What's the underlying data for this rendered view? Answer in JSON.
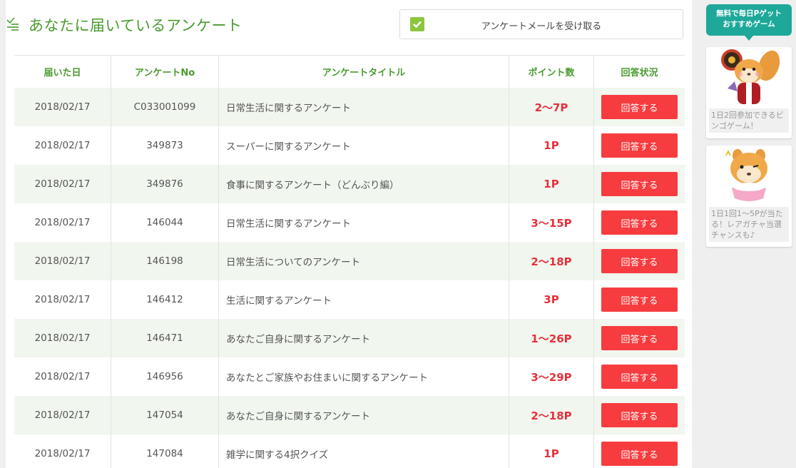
{
  "page": {
    "title": "あなたに届いているアンケート"
  },
  "mail_toggle": {
    "label": "アンケートメールを受け取る",
    "checked": true
  },
  "table": {
    "headers": [
      "届いた日",
      "アンケートNo",
      "アンケートタイトル",
      "ポイント数",
      "回答状況"
    ],
    "rows": [
      {
        "date": "2018/02/17",
        "no": "C033001099",
        "title": "日常生活に関するアンケート",
        "points": "2～7P",
        "action": "回答する"
      },
      {
        "date": "2018/02/17",
        "no": "349873",
        "title": "スーパーに関するアンケート",
        "points": "1P",
        "action": "回答する"
      },
      {
        "date": "2018/02/17",
        "no": "349876",
        "title": "食事に関するアンケート（どんぶり編）",
        "points": "1P",
        "action": "回答する"
      },
      {
        "date": "2018/02/17",
        "no": "146044",
        "title": "日常生活に関するアンケート",
        "points": "3～15P",
        "action": "回答する"
      },
      {
        "date": "2018/02/17",
        "no": "146198",
        "title": "日常生活についてのアンケート",
        "points": "2～18P",
        "action": "回答する"
      },
      {
        "date": "2018/02/17",
        "no": "146412",
        "title": "生活に関するアンケート",
        "points": "3P",
        "action": "回答する"
      },
      {
        "date": "2018/02/17",
        "no": "146471",
        "title": "あなたご自身に関するアンケート",
        "points": "1～26P",
        "action": "回答する"
      },
      {
        "date": "2018/02/17",
        "no": "146956",
        "title": "あなたとご家族やお住まいに関するアンケート",
        "points": "3～29P",
        "action": "回答する"
      },
      {
        "date": "2018/02/17",
        "no": "147054",
        "title": "あなたご自身に関するアンケート",
        "points": "2～18P",
        "action": "回答する"
      },
      {
        "date": "2018/02/17",
        "no": "147084",
        "title": "雑学に関する4択クイズ",
        "points": "1P",
        "action": "回答する"
      }
    ]
  },
  "sidebar": {
    "badge_line1": "無料で毎日Pゲット",
    "badge_line2": "おすすめゲーム",
    "cards": [
      {
        "name": "bingo",
        "icon": "squirrel-roulette-icon",
        "desc": "1日2回参加できるビンゴゲーム！"
      },
      {
        "name": "gacha",
        "icon": "squirrel-gacha-icon",
        "desc": "1日1回1～5Pが当たる！レアガチャ当選チャンスも♪"
      }
    ]
  },
  "colors": {
    "accent_green": "#4a9a2e",
    "row_alt_bg": "#f1f6ef",
    "points_red": "#e8303a",
    "button_red": "#f73c3f",
    "badge_teal": "#1ea89a",
    "checkbox_green": "#8cc63f"
  },
  "icons": {
    "header": "survey-list-icon",
    "checkbox": "checkmark-icon"
  }
}
